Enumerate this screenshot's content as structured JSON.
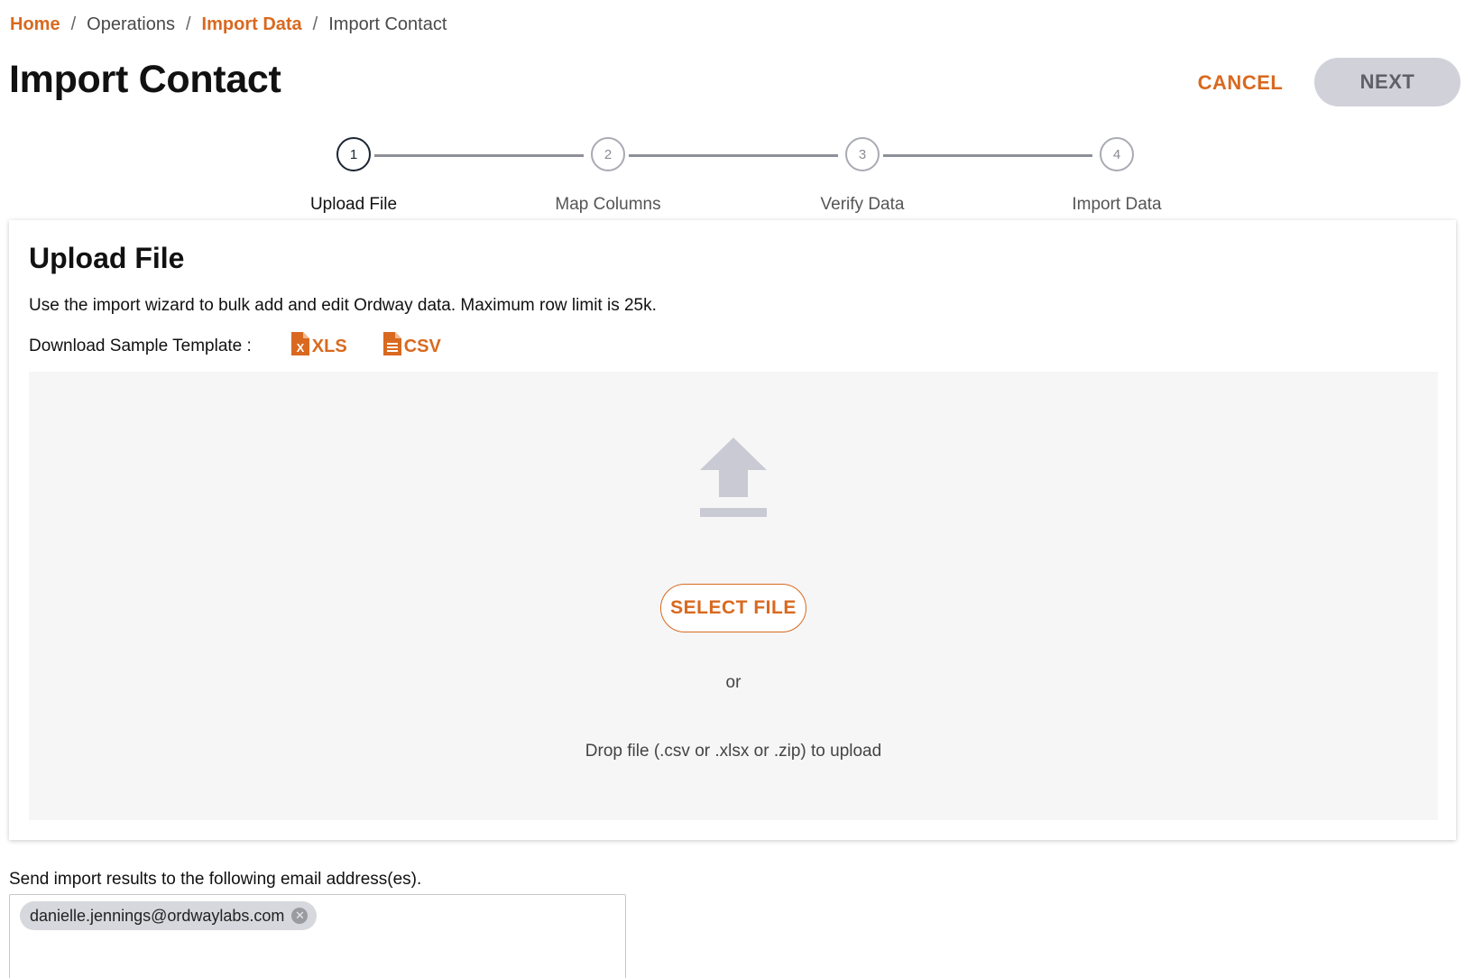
{
  "breadcrumb": {
    "home": "Home",
    "operations": "Operations",
    "import_data": "Import Data",
    "current": "Import Contact",
    "separator": "/"
  },
  "page_title": "Import Contact",
  "actions": {
    "cancel_label": "CANCEL",
    "next_label": "NEXT"
  },
  "stepper": {
    "steps": [
      {
        "number": "1",
        "label": "Upload File",
        "active": true
      },
      {
        "number": "2",
        "label": "Map Columns",
        "active": false
      },
      {
        "number": "3",
        "label": "Verify Data",
        "active": false
      },
      {
        "number": "4",
        "label": "Import Data",
        "active": false
      }
    ]
  },
  "upload_card": {
    "title": "Upload File",
    "description": "Use the import wizard to bulk add and edit Ordway data. Maximum row limit is 25k.",
    "template_label": "Download Sample Template :",
    "xls_label": "XLS",
    "csv_label": "CSV",
    "select_file_label": "SELECT FILE",
    "or_text": "or",
    "drop_text": "Drop file (.csv or .xlsx or .zip) to upload"
  },
  "email": {
    "label": "Send import results to the following email address(es).",
    "chips": [
      "danielle.jennings@ordwaylabs.com"
    ]
  },
  "colors": {
    "accent": "#d9691f",
    "next_bg": "#d0d1d9",
    "dropzone_bg": "#f6f6f6"
  },
  "icons": [
    "xls-file-icon",
    "csv-file-icon",
    "upload-icon",
    "chip-remove-icon"
  ]
}
